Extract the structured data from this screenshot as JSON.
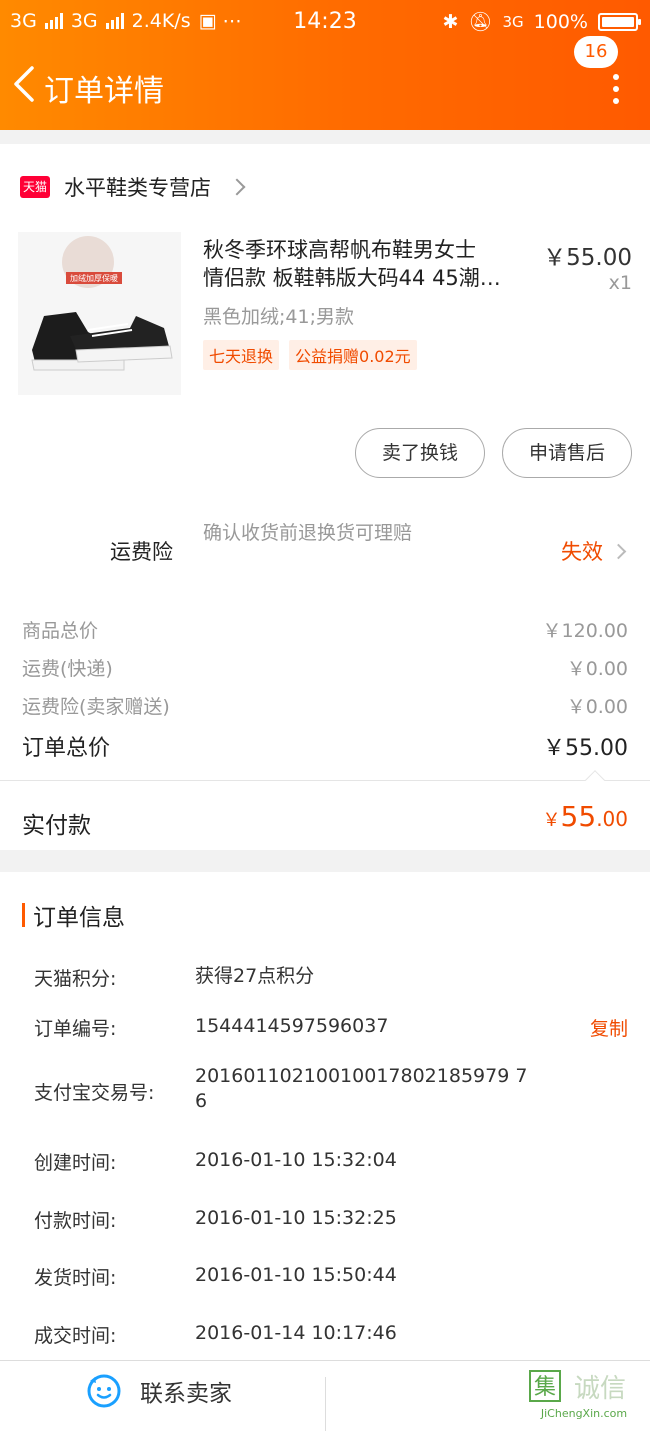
{
  "status_bar": {
    "left_text": "3G",
    "left_text2": "3G",
    "speed": "2.4K/s",
    "time": "14:23",
    "network": "3G",
    "battery": "100%"
  },
  "header": {
    "title": "订单详情",
    "badge": "16"
  },
  "shop": {
    "logo_text": "天猫",
    "name": "水平鞋类专营店"
  },
  "item": {
    "image_caption": "加绒加厚保暖",
    "title_line1": "秋冬季环球高帮帆布鞋男女士",
    "title_line2": "情侣款 板鞋韩版大码44 45潮…",
    "price": "￥55.00",
    "qty": "x1",
    "sku": "黑色加绒;41;男款",
    "tags": [
      "七天退换",
      "公益捐赠0.02元"
    ]
  },
  "actions": {
    "sell_label": "卖了换钱",
    "aftersale_label": "申请售后"
  },
  "insurance": {
    "label": "运费险",
    "desc": "确认收货前退换货可理赔",
    "status": "失效"
  },
  "prices": {
    "rows": [
      {
        "label": "商品总价",
        "value": "￥120.00"
      },
      {
        "label": "运费(快递)",
        "value": "￥0.00"
      },
      {
        "label": "运费险(卖家赠送)",
        "value": "￥0.00"
      }
    ],
    "total_label": "订单总价",
    "total_value": "￥55.00",
    "paid_label": "实付款",
    "paid_currency": "￥",
    "paid_int": "55",
    "paid_dec": ".00"
  },
  "order_info": {
    "heading": "订单信息",
    "rows": [
      {
        "key": "天猫积分:",
        "value": "获得27点积分"
      },
      {
        "key": "订单编号:",
        "value": "1544414597596037",
        "action": "复制"
      },
      {
        "key": "支付宝交易号:",
        "value": "20160110210010017802185979 76"
      },
      {
        "key": "创建时间:",
        "value": "2016-01-10 15:32:04"
      },
      {
        "key": "付款时间:",
        "value": "2016-01-10 15:32:25"
      },
      {
        "key": "发货时间:",
        "value": "2016-01-10 15:50:44"
      },
      {
        "key": "成交时间:",
        "value": "2016-01-14 10:17:46"
      }
    ]
  },
  "bottom": {
    "contact_label": "联系卖家",
    "watermark_text": "JiChengXin.com",
    "watermark_logo": "集诚信"
  },
  "colors": {
    "accent": "#ff5a00",
    "price_highlight": "#f04b00",
    "tmall_red": "#ff0036",
    "contact_icon": "#1aa0ff"
  }
}
